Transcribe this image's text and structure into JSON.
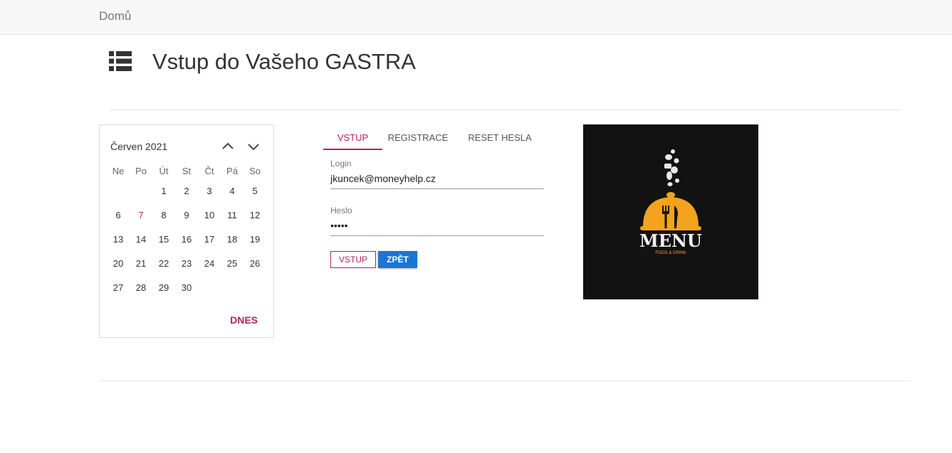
{
  "nav": {
    "home_label": "Domů"
  },
  "header": {
    "title": "Vstup do Vašeho GASTRA",
    "icon": "list-icon"
  },
  "calendar": {
    "month_label": "Červen 2021",
    "weekdays": [
      "Ne",
      "Po",
      "Út",
      "St",
      "Čt",
      "Pá",
      "So"
    ],
    "weeks": [
      [
        "",
        "",
        "1",
        "2",
        "3",
        "4",
        "5"
      ],
      [
        "6",
        "7",
        "8",
        "9",
        "10",
        "11",
        "12"
      ],
      [
        "13",
        "14",
        "15",
        "16",
        "17",
        "18",
        "19"
      ],
      [
        "20",
        "21",
        "22",
        "23",
        "24",
        "25",
        "26"
      ],
      [
        "27",
        "28",
        "29",
        "30",
        "",
        "",
        ""
      ]
    ],
    "selected_day": "7",
    "today_button": "DNES",
    "accent_color": "#b0245a"
  },
  "tabs": [
    {
      "label": "VSTUP",
      "active": true
    },
    {
      "label": "REGISTRACE",
      "active": false
    },
    {
      "label": "RESET HESLA",
      "active": false
    }
  ],
  "form": {
    "login_label": "Login",
    "login_value": "jkuncek@moneyhelp.cz",
    "password_label": "Heslo",
    "password_value": "•••••",
    "submit_label": "VSTUP",
    "back_label": "ZPĚT"
  },
  "logo": {
    "title": "MENU",
    "subtitle": "FOOD & DRINK"
  }
}
